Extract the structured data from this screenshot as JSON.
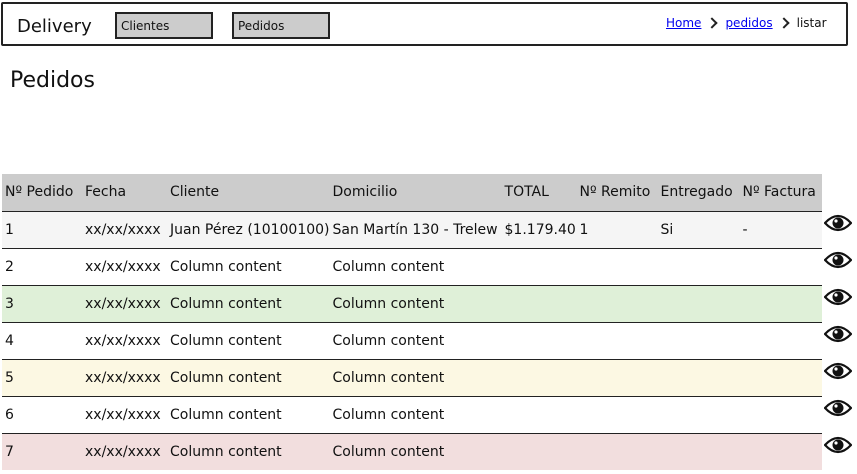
{
  "navbar": {
    "brand": "Delivery",
    "buttons": [
      "Clientes",
      "Pedidos"
    ]
  },
  "breadcrumb": {
    "items": [
      "Home",
      "pedidos"
    ],
    "current": "listar"
  },
  "page": {
    "title": "Pedidos"
  },
  "table": {
    "columns": [
      "Nº Pedido",
      "Fecha",
      "Cliente",
      "Domicilio",
      "TOTAL",
      "Nº Remito",
      "Entregado",
      "Nº Factura"
    ],
    "rows": [
      {
        "cells": [
          "1",
          "xx/xx/xxxx",
          "Juan Pérez (10100100)",
          "San Martín 130 - Trelew",
          "$1.179.40",
          "1",
          "Si",
          "-"
        ],
        "style": "light"
      },
      {
        "cells": [
          "2",
          "xx/xx/xxxx",
          "Column content",
          "Column content",
          "",
          "",
          "",
          ""
        ],
        "style": "default"
      },
      {
        "cells": [
          "3",
          "xx/xx/xxxx",
          "Column content",
          "Column content",
          "",
          "",
          "",
          ""
        ],
        "style": "success"
      },
      {
        "cells": [
          "4",
          "xx/xx/xxxx",
          "Column content",
          "Column content",
          "",
          "",
          "",
          ""
        ],
        "style": "default"
      },
      {
        "cells": [
          "5",
          "xx/xx/xxxx",
          "Column content",
          "Column content",
          "",
          "",
          "",
          ""
        ],
        "style": "warning"
      },
      {
        "cells": [
          "6",
          "xx/xx/xxxx",
          "Column content",
          "Column content",
          "",
          "",
          "",
          ""
        ],
        "style": "default"
      },
      {
        "cells": [
          "7",
          "xx/xx/xxxx",
          "Column content",
          "Column content",
          "",
          "",
          "",
          ""
        ],
        "style": "danger"
      }
    ]
  },
  "row_action_icon": "eye-icon",
  "colors": {
    "header_bg": "#cccccc",
    "row_light": "#f5f5f5",
    "row_success": "#dff0d8",
    "row_warning": "#fcf8e3",
    "row_danger": "#f2dede",
    "link": "#0000ee"
  }
}
